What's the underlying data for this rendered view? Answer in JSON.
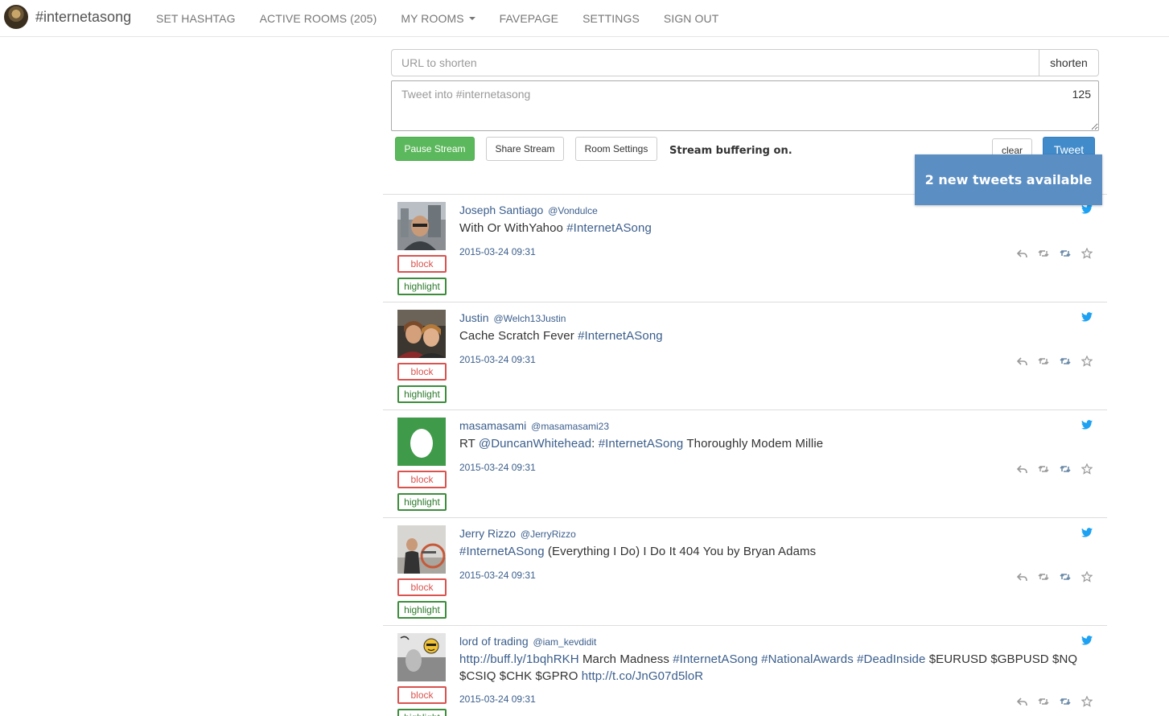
{
  "nav": {
    "brand": "#internetasong",
    "items": [
      {
        "label": "SET HASHTAG"
      },
      {
        "label": "ACTIVE ROOMS (205)"
      },
      {
        "label": "MY ROOMS"
      },
      {
        "label": "FAVEPAGE"
      },
      {
        "label": "SETTINGS"
      },
      {
        "label": "SIGN OUT"
      }
    ]
  },
  "shortener": {
    "placeholder": "URL to shorten",
    "button": "shorten"
  },
  "composer": {
    "placeholder": "Tweet into #internetasong",
    "char_count": "125"
  },
  "controls": {
    "pause": "Pause Stream",
    "share": "Share Stream",
    "room_settings": "Room Settings",
    "status": "Stream buffering on.",
    "clear": "clear",
    "tweet": "Tweet",
    "new_tweets": "2 new tweets available"
  },
  "tweet_buttons": {
    "block": "block",
    "highlight": "highlight"
  },
  "colors": {
    "link": "#3b5e8c",
    "pause_green": "#5cb85c",
    "tweet_blue": "#428bca",
    "notice_blue": "#5b8ec3",
    "block_red": "#d9534f",
    "highlight_green": "#3c8c3c",
    "twitter_blue": "#1da1f2"
  },
  "tweets": [
    {
      "name": "Joseph Santiago",
      "handle": "@Vondulce",
      "segments": [
        {
          "text": "With Or WithYahoo ",
          "link": false
        },
        {
          "text": "#InternetASong",
          "link": true
        }
      ],
      "time": "2015-03-24 09:31",
      "avatar": "avatar-photo-man"
    },
    {
      "name": "Justin",
      "handle": "@Welch13Justin",
      "segments": [
        {
          "text": "Cache Scratch Fever ",
          "link": false
        },
        {
          "text": "#InternetASong",
          "link": true
        }
      ],
      "time": "2015-03-24 09:31",
      "avatar": "avatar-photo-couple"
    },
    {
      "name": "masamasami",
      "handle": "@masamasami23",
      "segments": [
        {
          "text": "RT ",
          "link": false
        },
        {
          "text": "@DuncanWhitehead",
          "link": true
        },
        {
          "text": ": ",
          "link": false
        },
        {
          "text": "#InternetASong",
          "link": true
        },
        {
          "text": " Thoroughly Modem Millie",
          "link": false
        }
      ],
      "time": "2015-03-24 09:31",
      "avatar": "egg-avatar"
    },
    {
      "name": "Jerry Rizzo",
      "handle": "@JerryRizzo",
      "segments": [
        {
          "text": "#InternetASong",
          "link": true
        },
        {
          "text": " (Everything I Do) I Do It 404 You by Bryan Adams",
          "link": false
        }
      ],
      "time": "2015-03-24 09:31",
      "avatar": "avatar-photo-room"
    },
    {
      "name": "lord of trading",
      "handle": "@iam_kevdidit",
      "segments": [
        {
          "text": "http://buff.ly/1bqhRKH",
          "link": true
        },
        {
          "text": " March Madness ",
          "link": false
        },
        {
          "text": "#InternetASong",
          "link": true
        },
        {
          "text": " ",
          "link": false
        },
        {
          "text": "#NationalAwards",
          "link": true
        },
        {
          "text": " ",
          "link": false
        },
        {
          "text": "#DeadInside",
          "link": true
        },
        {
          "text": " $EURUSD $GBPUSD $NQ $CSIQ $CHK $GPRO ",
          "link": false
        },
        {
          "text": "http://t.co/JnG07d5loR",
          "link": true
        }
      ],
      "time": "2015-03-24 09:31",
      "avatar": "avatar-photo-emoji"
    }
  ]
}
